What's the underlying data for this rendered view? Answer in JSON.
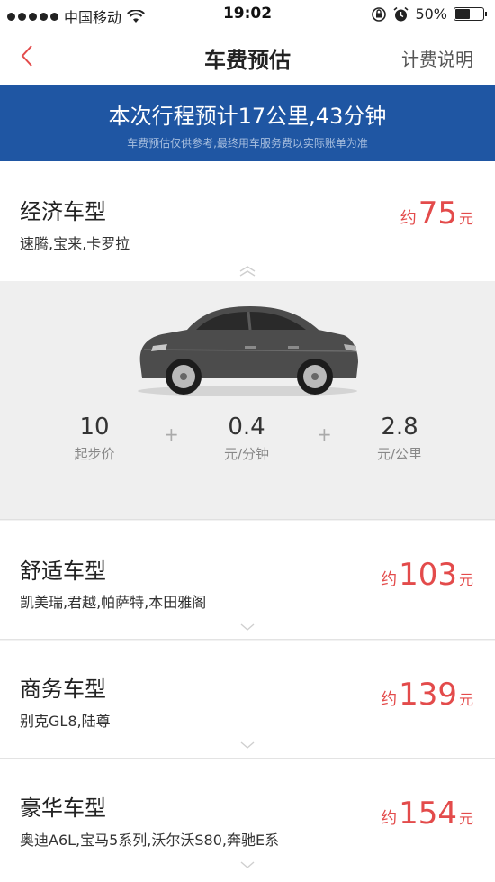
{
  "status_bar": {
    "carrier": "中国移动",
    "time": "19:02",
    "battery": "50%"
  },
  "nav": {
    "title": "车费预估",
    "help_label": "计费说明"
  },
  "banner": {
    "main": "本次行程预计17公里,43分钟",
    "sub": "车费预估仅供参考,最终用车服务费以实际账单为准"
  },
  "cars": [
    {
      "name": "经济车型",
      "models": "速腾,宝来,卡罗拉",
      "price_prefix": "约",
      "price": "75",
      "price_unit": "元"
    },
    {
      "name": "舒适车型",
      "models": "凯美瑞,君越,帕萨特,本田雅阁",
      "price_prefix": "约",
      "price": "103",
      "price_unit": "元"
    },
    {
      "name": "商务车型",
      "models": "别克GL8,陆尊",
      "price_prefix": "约",
      "price": "139",
      "price_unit": "元"
    },
    {
      "name": "豪华车型",
      "models": "奥迪A6L,宝马5系列,沃尔沃S80,奔驰E系",
      "price_prefix": "约",
      "price": "154",
      "price_unit": "元"
    }
  ],
  "fees": [
    {
      "value": "10",
      "label": "起步价"
    },
    {
      "value": "0.4",
      "label": "元/分钟"
    },
    {
      "value": "2.8",
      "label": "元/公里"
    }
  ],
  "fee_separator": "+",
  "colors": {
    "brand_blue": "#1f56a3",
    "price_red": "#e34b4b",
    "back_red": "#e34b4b"
  }
}
